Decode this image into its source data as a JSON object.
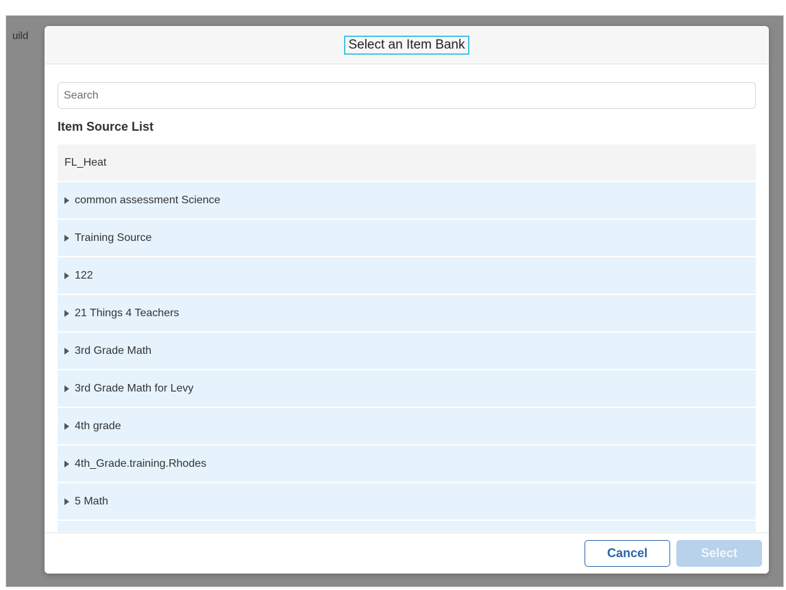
{
  "background": {
    "partial_text": "uild"
  },
  "modal": {
    "title": "Select an Item Bank",
    "search": {
      "placeholder": "Search",
      "value": ""
    },
    "list_heading": "Item Source List",
    "items": [
      {
        "label": "FL_Heat",
        "expandable": false
      },
      {
        "label": "common assessment Science",
        "expandable": true
      },
      {
        "label": "Training Source",
        "expandable": true
      },
      {
        "label": "122",
        "expandable": true
      },
      {
        "label": "21 Things 4 Teachers",
        "expandable": true
      },
      {
        "label": "3rd Grade Math",
        "expandable": true
      },
      {
        "label": "3rd Grade Math for Levy",
        "expandable": true
      },
      {
        "label": "4th grade",
        "expandable": true
      },
      {
        "label": "4th_Grade.training.Rhodes",
        "expandable": true
      },
      {
        "label": "5 Math",
        "expandable": true
      }
    ],
    "footer": {
      "cancel_label": "Cancel",
      "select_label": "Select"
    }
  },
  "colors": {
    "list_item_bg": "#e6f3fc",
    "primary": "#2766a8",
    "select_disabled": "#b7d2ea",
    "focus_outline": "#45c4e6"
  }
}
